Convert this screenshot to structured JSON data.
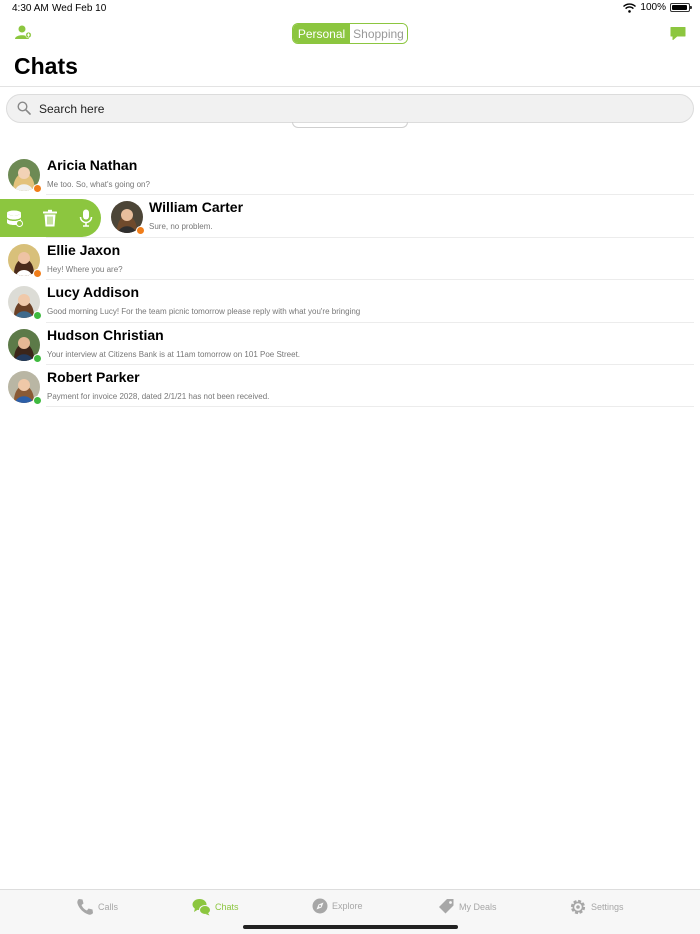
{
  "status_bar": {
    "time": "4:30 AM",
    "date": "Wed Feb 10",
    "battery": "100%"
  },
  "segments": {
    "personal": "Personal",
    "shopping": "Shopping",
    "selected": "Personal"
  },
  "title": "Chats",
  "search": {
    "placeholder": "Search here"
  },
  "colors": {
    "accent": "#8cc63f",
    "status_online": "#3fba3f",
    "status_away": "#f07d1a"
  },
  "chats": [
    {
      "name": "Aricia Nathan",
      "preview": "Me too. So, what's going on?",
      "status": "away"
    },
    {
      "name": "William Carter",
      "preview": "Sure, no problem.",
      "status": "away",
      "swiped": true
    },
    {
      "name": "Ellie Jaxon",
      "preview": "Hey! Where you are?",
      "status": "away"
    },
    {
      "name": "Lucy Addison",
      "preview": "Good morning Lucy! For the team picnic tomorrow please reply with what you're bringing",
      "status": "online"
    },
    {
      "name": "Hudson Christian",
      "preview": "Your interview at Citizens Bank is at 11am tomorrow on 101 Poe Street.",
      "status": "online"
    },
    {
      "name": "Robert Parker",
      "preview": "Payment for invoice 2028, dated 2/1/21 has not been received.",
      "status": "online"
    }
  ],
  "swipe_actions": [
    "archive-icon",
    "trash-icon",
    "microphone-icon"
  ],
  "tabs": [
    {
      "label": "Calls",
      "icon": "phone-icon"
    },
    {
      "label": "Chats",
      "icon": "chat-bubbles-icon",
      "active": true
    },
    {
      "label": "Explore",
      "icon": "compass-icon"
    },
    {
      "label": "My Deals",
      "icon": "tag-icon"
    },
    {
      "label": "Settings",
      "icon": "gear-icon"
    }
  ]
}
